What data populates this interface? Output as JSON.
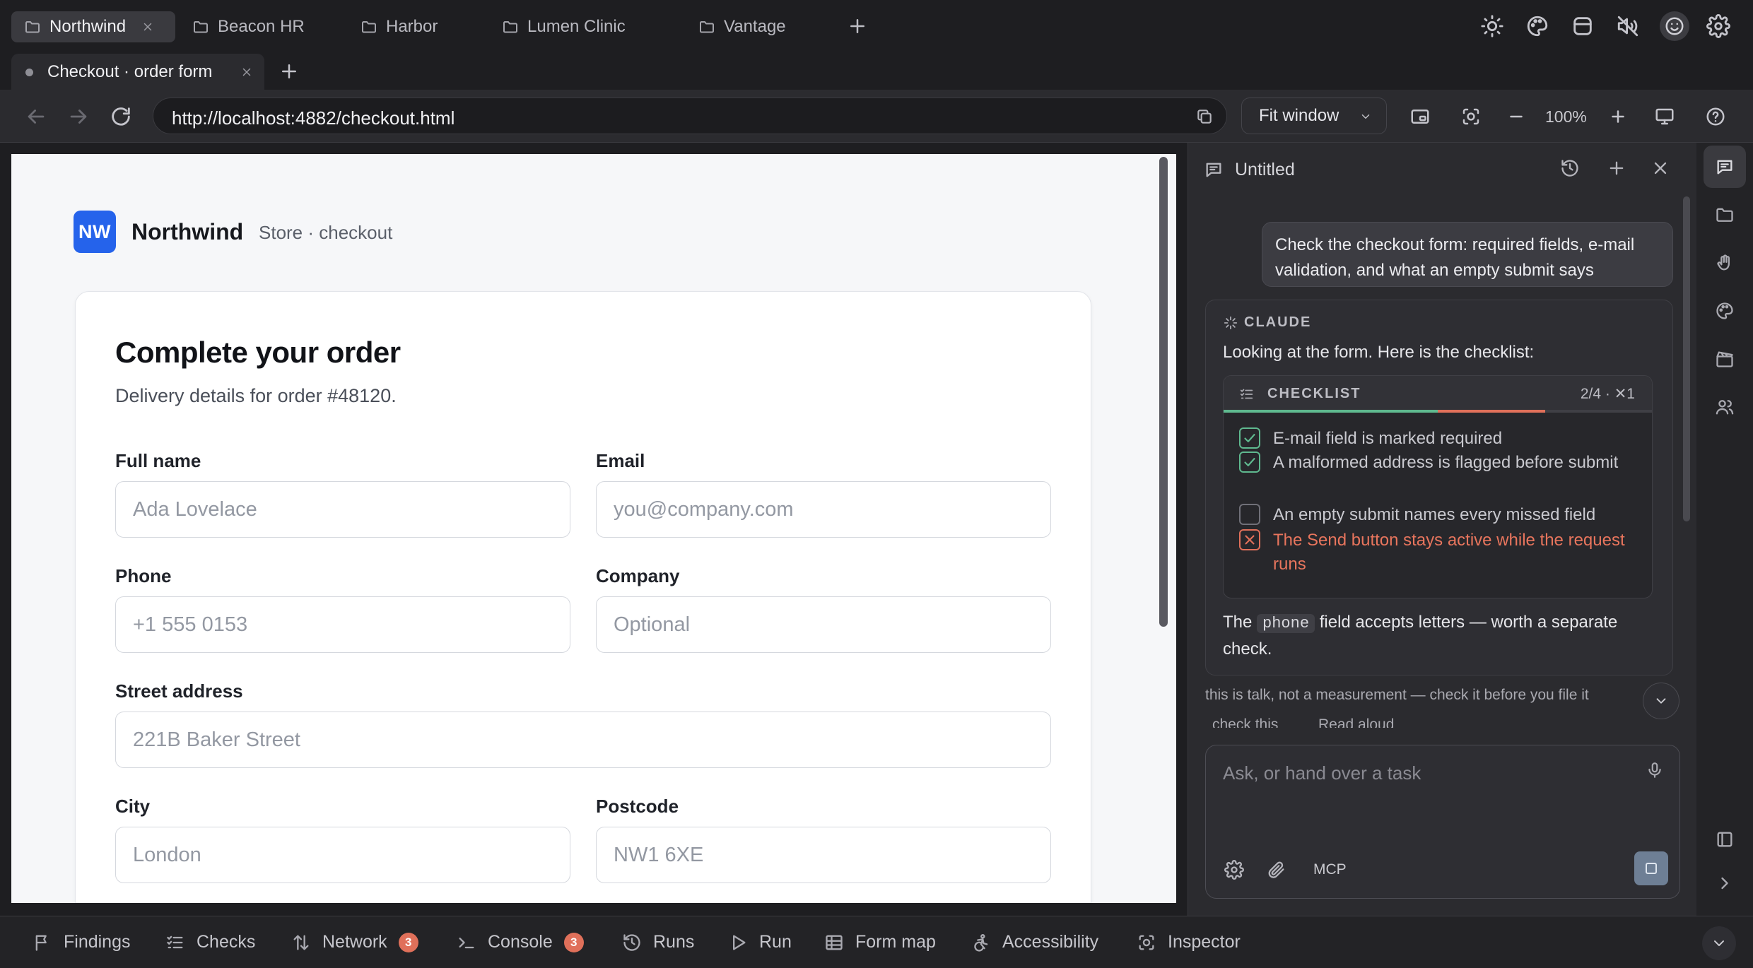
{
  "workspace_tabs": [
    {
      "label": "Northwind",
      "active": true
    },
    {
      "label": "Beacon HR",
      "active": false
    },
    {
      "label": "Harbor",
      "active": false
    },
    {
      "label": "Lumen Clinic",
      "active": false
    },
    {
      "label": "Vantage",
      "active": false
    }
  ],
  "top_icons": [
    "sun-icon",
    "palette-icon",
    "database-icon",
    "mute-icon",
    "smile-icon",
    "gear-icon"
  ],
  "page_tab": {
    "label": "Checkout · order form"
  },
  "toolbar": {
    "url": "http://localhost:4882/checkout.html",
    "fit_label": "Fit window",
    "zoom": "100%"
  },
  "page": {
    "brand": {
      "logo": "NW",
      "name": "Northwind",
      "sub": "Store · checkout"
    },
    "card": {
      "title": "Complete your order",
      "subtitle": "Delivery details for order #48120."
    },
    "fields": {
      "full_name": {
        "label": "Full name",
        "placeholder": "Ada Lovelace"
      },
      "email": {
        "label": "Email",
        "placeholder": "you@company.com"
      },
      "phone": {
        "label": "Phone",
        "placeholder": "+1 555 0153"
      },
      "company": {
        "label": "Company",
        "placeholder": "Optional"
      },
      "street": {
        "label": "Street address",
        "placeholder": "221B Baker Street"
      },
      "city": {
        "label": "City",
        "placeholder": "London"
      },
      "postcode": {
        "label": "Postcode",
        "placeholder": "NW1 6XE"
      }
    }
  },
  "chat": {
    "title": "Untitled",
    "user_message": "Check the checkout form: required fields, e-mail validation, and what an empty submit says",
    "assistant": {
      "tag": "CLAUDE",
      "intro": "Looking at the form. Here is the checklist:",
      "outro_before": "The ",
      "outro_code": "phone",
      "outro_after": " field accepts letters — worth a separate check."
    },
    "checklist": {
      "title": "CHECKLIST",
      "count": "2/4 · ✕1",
      "passed": 2,
      "failed": 1,
      "total": 4,
      "items": [
        {
          "text": "E-mail field is marked required",
          "status": "pass"
        },
        {
          "text": "A malformed address is flagged before submit",
          "status": "pass"
        },
        {
          "text": "An empty submit names every missed field",
          "status": "pending"
        },
        {
          "text": "The Send button stays active while the request runs",
          "status": "fail"
        }
      ]
    },
    "disclaimer": "this is talk, not a measurement — check it before you file it",
    "links": [
      "check this",
      "Read aloud"
    ],
    "composer": {
      "placeholder": "Ask, or hand over a task",
      "mcp_label": "MCP"
    }
  },
  "bottom_tabs": [
    {
      "label": "Findings",
      "icon": "flag-icon"
    },
    {
      "label": "Checks",
      "icon": "list-check-icon"
    },
    {
      "label": "Network",
      "icon": "arrows-icon",
      "badge": "3"
    },
    {
      "label": "Console",
      "icon": "terminal-icon",
      "badge": "3"
    },
    {
      "label": "Runs",
      "icon": "history-icon"
    },
    {
      "label": "Run",
      "icon": "play-icon"
    },
    {
      "label": "Form map",
      "icon": "table-icon"
    },
    {
      "label": "Accessibility",
      "icon": "accessibility-icon"
    },
    {
      "label": "Inspector",
      "icon": "target-icon"
    }
  ],
  "colors": {
    "brand": "#2563eb",
    "pass": "#5fb98f",
    "fail": "#e0705a",
    "badge": "#e0705a"
  }
}
